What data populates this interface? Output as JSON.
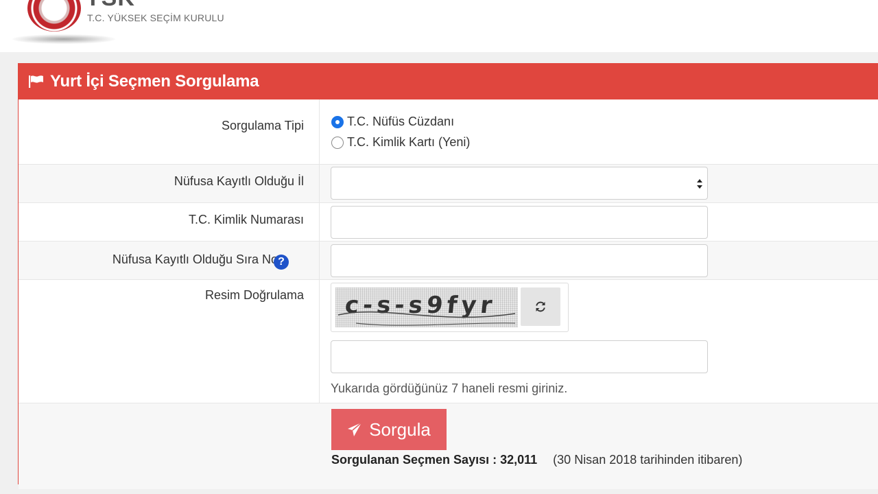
{
  "header": {
    "logo_abbr": "YSK",
    "logo_name": "T.C. YÜKSEK SEÇİM KURULU"
  },
  "panel": {
    "title": "Yurt İçi Seçmen Sorgulama",
    "icon": "flag-icon"
  },
  "form": {
    "type": {
      "label": "Sorgulama Tipi",
      "options": [
        {
          "label": "T.C. Nüfüs Cüzdanı",
          "checked": true
        },
        {
          "label": "T.C. Kimlik Kartı (Yeni)",
          "checked": false
        }
      ]
    },
    "province": {
      "label": "Nüfusa Kayıtlı Olduğu İl",
      "value": ""
    },
    "tc_number": {
      "label": "T.C. Kimlik Numarası",
      "value": ""
    },
    "sequence_no": {
      "label": "Nüfusa Kayıtlı Olduğu Sıra No",
      "help_icon": "question-circle-icon",
      "value": ""
    },
    "captcha": {
      "label": "Resim Doğrulama",
      "image_text": "c-s-s9fyr",
      "refresh_icon": "refresh-icon",
      "value": "",
      "hint": "Yukarıda gördüğünüz 7 haneli resmi giriniz."
    }
  },
  "submit": {
    "label": "Sorgula",
    "icon": "paper-plane-icon",
    "count_label": "Sorgulanan Seçmen Sayısı : 32,011",
    "count_note": "(30 Nisan 2018 tarihinden itibaren)"
  },
  "colors": {
    "accent": "#e0463e",
    "button": "#e45f63",
    "radio_checked": "#1a73e8",
    "help_icon": "#1f53c9"
  }
}
